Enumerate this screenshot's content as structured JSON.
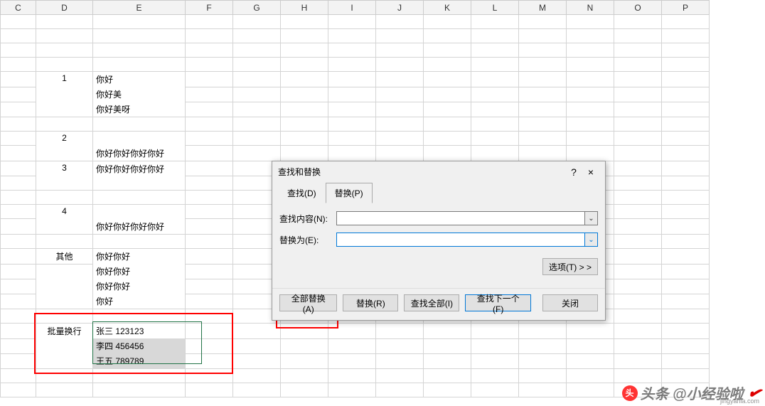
{
  "columns": [
    "C",
    "D",
    "E",
    "F",
    "G",
    "H",
    "I",
    "J",
    "K",
    "L",
    "M",
    "N",
    "O",
    "P"
  ],
  "cells": {
    "D_r4": "1",
    "E_r4a": "你好",
    "E_r4b": "你好美",
    "E_r4c": "你好美呀",
    "D_r5": "2",
    "E_r5": "你好你好你好你好",
    "D_r6": "3",
    "E_r6": "你好你好你好你好",
    "D_r7": "4",
    "E_r7": "你好你好你好你好",
    "D_r8": "其他",
    "E_r8a": "你好你好",
    "E_r8b": "你好你好",
    "E_r8c": "你好你好",
    "E_r8d": "你好",
    "D_r9": "批量换行",
    "E_r9a": "张三 123123",
    "E_r9b": "李四 456456",
    "E_r9c": "王五 789789"
  },
  "dialog": {
    "title": "查找和替换",
    "help": "?",
    "close": "×",
    "tab_find": "查找(D)",
    "tab_replace": "替换(P)",
    "label_find": "查找内容(N):",
    "label_replace": "替换为(E):",
    "find_value": "",
    "replace_value": "",
    "options_btn": "选项(T) > >",
    "btn_replace_all": "全部替换(A)",
    "btn_replace": "替换(R)",
    "btn_find_all": "查找全部(I)",
    "btn_find_next": "查找下一个(F)",
    "btn_close": "关闭"
  },
  "watermark": {
    "text": "头条 @小经验啦",
    "sub": "jingyanla.com"
  },
  "chart_data": null
}
